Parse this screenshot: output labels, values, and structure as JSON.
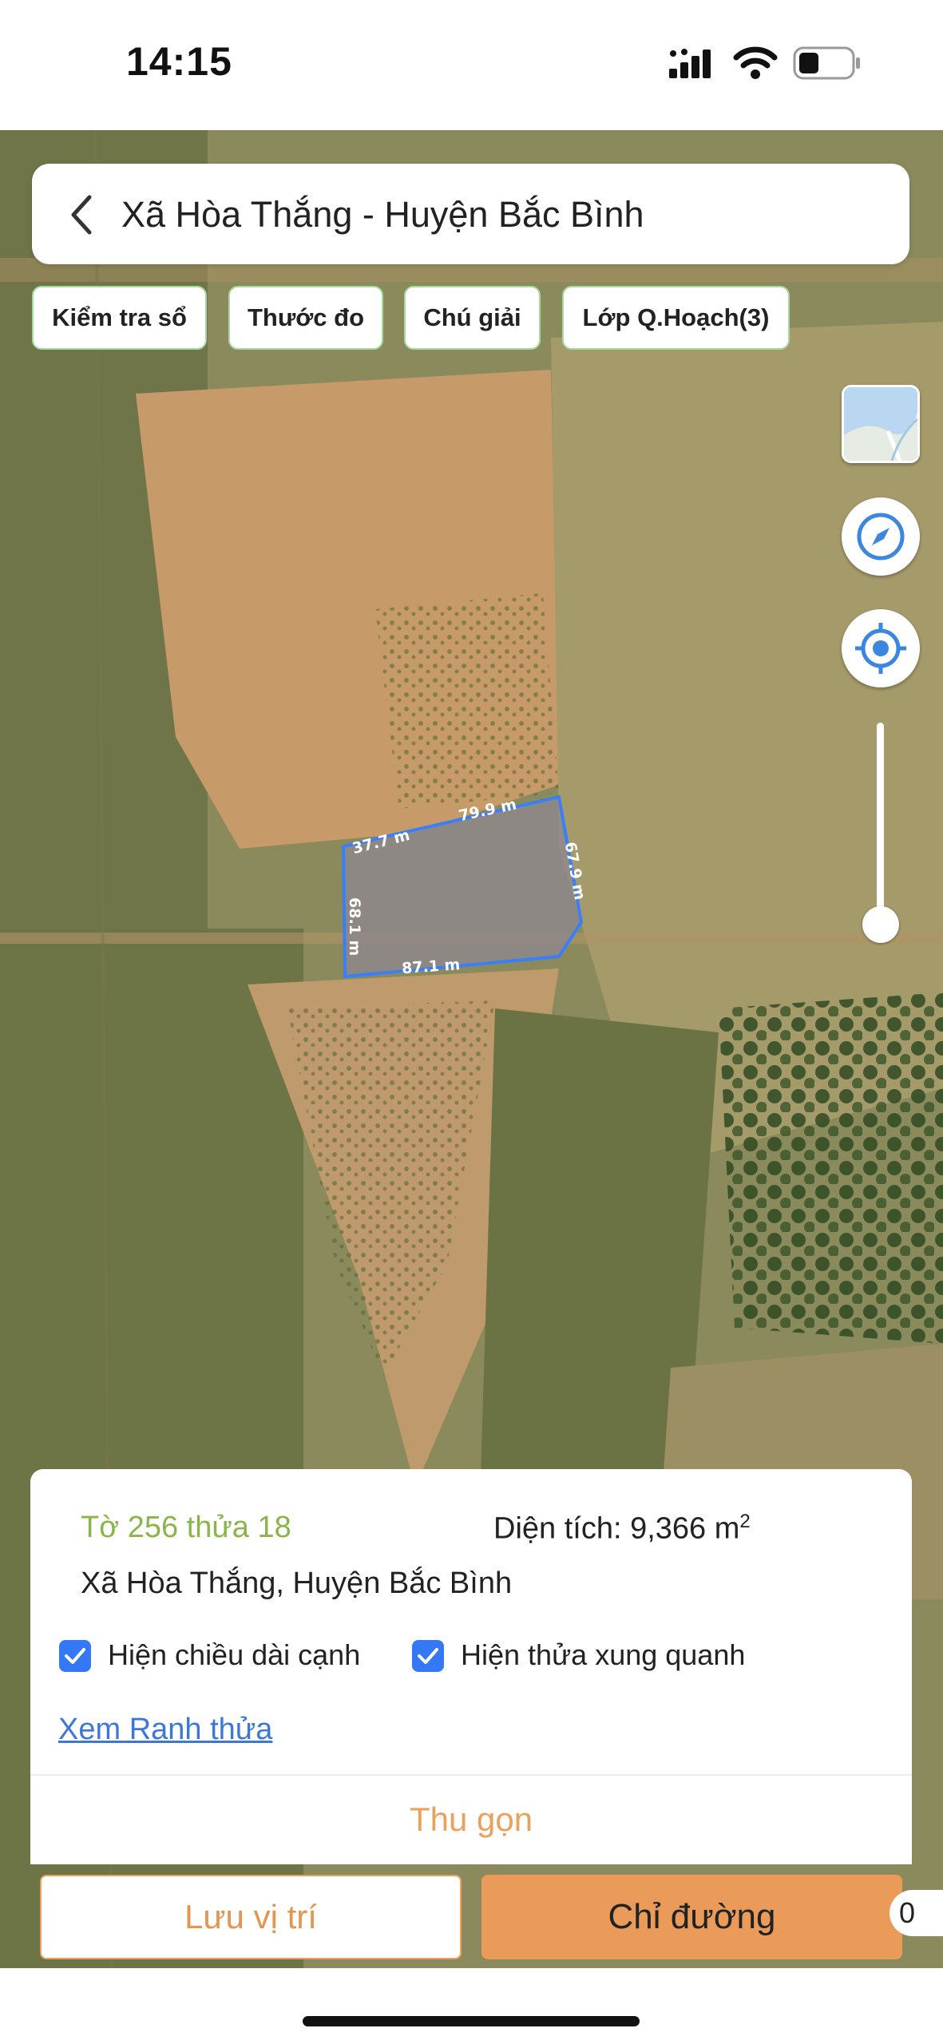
{
  "status_bar": {
    "time": "14:15"
  },
  "header": {
    "title": "Xã Hòa Thắng - Huyện Bắc Bình"
  },
  "chips": [
    {
      "label": "Kiểm tra sổ"
    },
    {
      "label": "Thước đo"
    },
    {
      "label": "Chú giải"
    },
    {
      "label": "Lớp Q.Hoạch(3)"
    }
  ],
  "map": {
    "edge_labels": [
      "37.7 m",
      "79.9 m",
      "67.9 m",
      "68.1 m",
      "87.1 m"
    ],
    "parcel_outline_color": "#3a7ff5"
  },
  "info": {
    "parcel_id": "Tờ 256 thửa 18",
    "area_label": "Diện tích: 9,366 m",
    "area_unit_sup": "2",
    "address": "Xã Hòa Thắng, Huyện Bắc Bình",
    "checkboxes": [
      {
        "label": "Hiện chiều dài cạnh",
        "checked": true
      },
      {
        "label": "Hiện thửa xung quanh",
        "checked": true
      }
    ],
    "link": "Xem Ranh thửa",
    "collapse": "Thu gọn"
  },
  "actions": {
    "save": "Lưu vị trí",
    "route": "Chỉ đường",
    "side_badge": "0"
  },
  "colors": {
    "accent_orange": "#ea9b59",
    "parcel_green_text": "#8ab54a",
    "link_blue": "#3d78d8",
    "checkbox_blue": "#3478f6"
  }
}
